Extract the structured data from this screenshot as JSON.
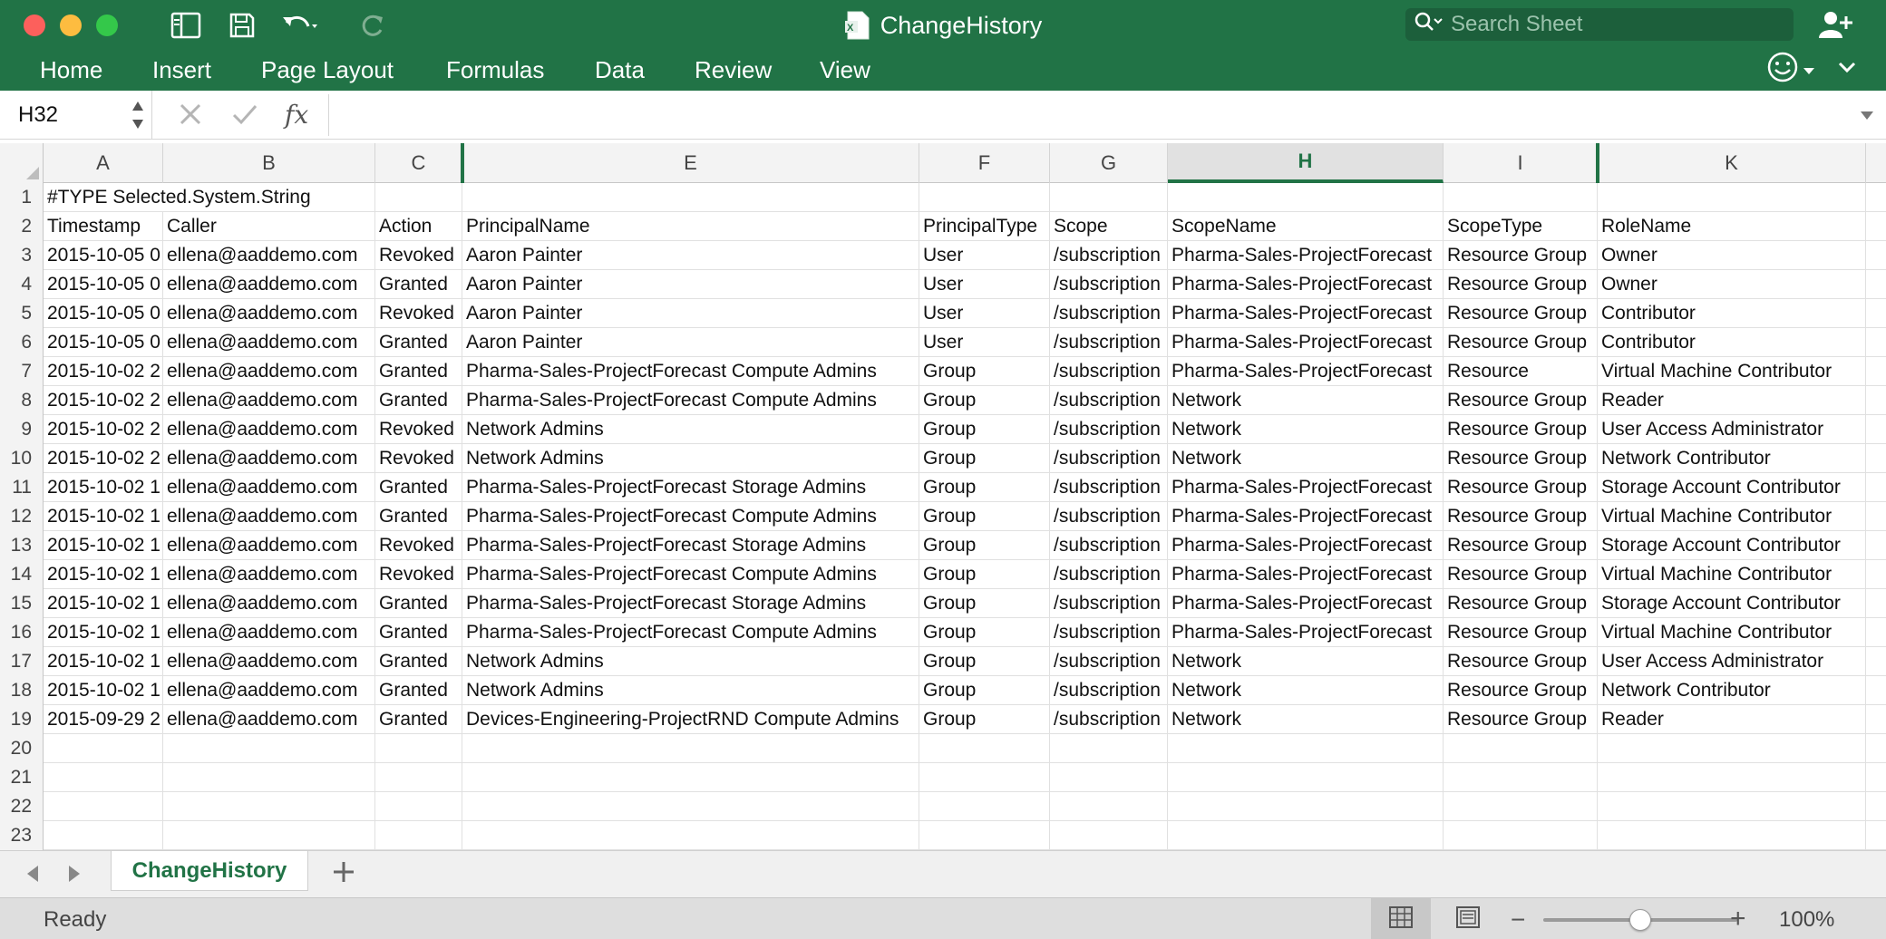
{
  "window": {
    "title": "ChangeHistory",
    "search_placeholder": "Search Sheet"
  },
  "ribbon": {
    "tabs": [
      "Home",
      "Insert",
      "Page Layout",
      "Formulas",
      "Data",
      "Review",
      "View"
    ]
  },
  "formula_bar": {
    "cell_ref": "H32",
    "fx_label": "fx",
    "value": ""
  },
  "grid": {
    "columns": [
      "A",
      "B",
      "C",
      "E",
      "F",
      "G",
      "H",
      "I",
      "K"
    ],
    "selected_column": "H",
    "row_numbers": [
      "1",
      "2",
      "3",
      "4",
      "5",
      "6",
      "7",
      "8",
      "9",
      "10",
      "11",
      "12",
      "13",
      "14",
      "15",
      "16",
      "17",
      "18",
      "19",
      "20",
      "21",
      "22",
      "23"
    ],
    "rows": [
      [
        "#TYPE Selected.System.String",
        "",
        "",
        "",
        "",
        "",
        "",
        "",
        ""
      ],
      [
        "Timestamp",
        "Caller",
        "Action",
        "PrincipalName",
        "PrincipalType",
        "Scope",
        "ScopeName",
        "ScopeType",
        "RoleName"
      ],
      [
        "2015-10-05 0",
        "ellena@aaddemo.com",
        "Revoked",
        "Aaron Painter",
        "User",
        "/subscription",
        "Pharma-Sales-ProjectForecast",
        "Resource Group",
        "Owner"
      ],
      [
        "2015-10-05 0",
        "ellena@aaddemo.com",
        "Granted",
        "Aaron Painter",
        "User",
        "/subscription",
        "Pharma-Sales-ProjectForecast",
        "Resource Group",
        "Owner"
      ],
      [
        "2015-10-05 0",
        "ellena@aaddemo.com",
        "Revoked",
        "Aaron Painter",
        "User",
        "/subscription",
        "Pharma-Sales-ProjectForecast",
        "Resource Group",
        "Contributor"
      ],
      [
        "2015-10-05 0",
        "ellena@aaddemo.com",
        "Granted",
        "Aaron Painter",
        "User",
        "/subscription",
        "Pharma-Sales-ProjectForecast",
        "Resource Group",
        "Contributor"
      ],
      [
        "2015-10-02 2",
        "ellena@aaddemo.com",
        "Granted",
        "Pharma-Sales-ProjectForecast Compute Admins",
        "Group",
        "/subscription",
        "Pharma-Sales-ProjectForecast",
        "Resource",
        "Virtual Machine Contributor"
      ],
      [
        "2015-10-02 2",
        "ellena@aaddemo.com",
        "Granted",
        "Pharma-Sales-ProjectForecast Compute Admins",
        "Group",
        "/subscription",
        "Network",
        "Resource Group",
        "Reader"
      ],
      [
        "2015-10-02 2",
        "ellena@aaddemo.com",
        "Revoked",
        "Network Admins",
        "Group",
        "/subscription",
        "Network",
        "Resource Group",
        "User Access Administrator"
      ],
      [
        "2015-10-02 2",
        "ellena@aaddemo.com",
        "Revoked",
        "Network Admins",
        "Group",
        "/subscription",
        "Network",
        "Resource Group",
        "Network Contributor"
      ],
      [
        "2015-10-02 1",
        "ellena@aaddemo.com",
        "Granted",
        "Pharma-Sales-ProjectForecast Storage Admins",
        "Group",
        "/subscription",
        "Pharma-Sales-ProjectForecast",
        "Resource Group",
        "Storage Account Contributor"
      ],
      [
        "2015-10-02 1",
        "ellena@aaddemo.com",
        "Granted",
        "Pharma-Sales-ProjectForecast Compute Admins",
        "Group",
        "/subscription",
        "Pharma-Sales-ProjectForecast",
        "Resource Group",
        "Virtual Machine Contributor"
      ],
      [
        "2015-10-02 1",
        "ellena@aaddemo.com",
        "Revoked",
        "Pharma-Sales-ProjectForecast Storage Admins",
        "Group",
        "/subscription",
        "Pharma-Sales-ProjectForecast",
        "Resource Group",
        "Storage Account Contributor"
      ],
      [
        "2015-10-02 1",
        "ellena@aaddemo.com",
        "Revoked",
        "Pharma-Sales-ProjectForecast Compute Admins",
        "Group",
        "/subscription",
        "Pharma-Sales-ProjectForecast",
        "Resource Group",
        "Virtual Machine Contributor"
      ],
      [
        "2015-10-02 1",
        "ellena@aaddemo.com",
        "Granted",
        "Pharma-Sales-ProjectForecast Storage Admins",
        "Group",
        "/subscription",
        "Pharma-Sales-ProjectForecast",
        "Resource Group",
        "Storage Account Contributor"
      ],
      [
        "2015-10-02 1",
        "ellena@aaddemo.com",
        "Granted",
        "Pharma-Sales-ProjectForecast Compute Admins",
        "Group",
        "/subscription",
        "Pharma-Sales-ProjectForecast",
        "Resource Group",
        "Virtual Machine Contributor"
      ],
      [
        "2015-10-02 1",
        "ellena@aaddemo.com",
        "Granted",
        "Network Admins",
        "Group",
        "/subscription",
        "Network",
        "Resource Group",
        "User Access Administrator"
      ],
      [
        "2015-10-02 1",
        "ellena@aaddemo.com",
        "Granted",
        "Network Admins",
        "Group",
        "/subscription",
        "Network",
        "Resource Group",
        "Network Contributor"
      ],
      [
        "2015-09-29 2",
        "ellena@aaddemo.com",
        "Granted",
        "Devices-Engineering-ProjectRND Compute Admins",
        "Group",
        "/subscription",
        "Network",
        "Resource Group",
        "Reader"
      ],
      [
        "",
        "",
        "",
        "",
        "",
        "",
        "",
        "",
        ""
      ],
      [
        "",
        "",
        "",
        "",
        "",
        "",
        "",
        "",
        ""
      ],
      [
        "",
        "",
        "",
        "",
        "",
        "",
        "",
        "",
        ""
      ],
      [
        "",
        "",
        "",
        "",
        "",
        "",
        "",
        "",
        ""
      ]
    ]
  },
  "sheet_tabs": [
    "ChangeHistory"
  ],
  "status_bar": {
    "status": "Ready",
    "zoom_level": "100%",
    "zoom_fraction": 0.5
  },
  "colors": {
    "brand": "#217346",
    "selected_header_text": "#217346"
  }
}
